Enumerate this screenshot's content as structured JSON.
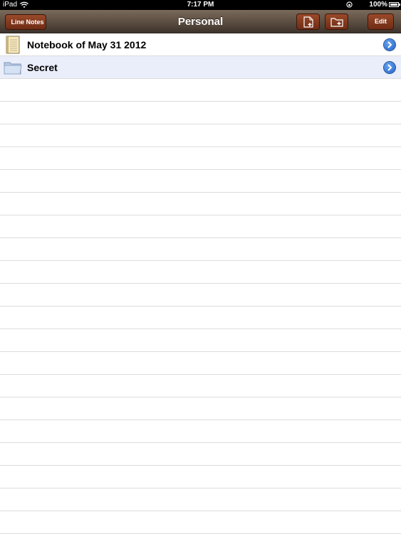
{
  "status_bar": {
    "carrier": "iPad",
    "time": "7:17 PM",
    "battery_percent": "100%",
    "icons": [
      "wifi-icon",
      "rotation-lock-icon",
      "battery-icon"
    ]
  },
  "nav_bar": {
    "back_label": "Line Notes",
    "title": "Personal",
    "edit_label": "Edit",
    "icons": [
      "new-note-icon",
      "new-folder-icon"
    ]
  },
  "list": {
    "items": [
      {
        "label": "Notebook of May 31 2012",
        "icon": "notebook-icon",
        "selected": false
      },
      {
        "label": "Secret",
        "icon": "folder-icon",
        "selected": true
      }
    ],
    "empty_rows": 20
  },
  "colors": {
    "nav_bar": "#5a4c40",
    "button": "#7a3519",
    "selected_row": "#eaeefa",
    "disclosure": "#2f6fd0"
  }
}
